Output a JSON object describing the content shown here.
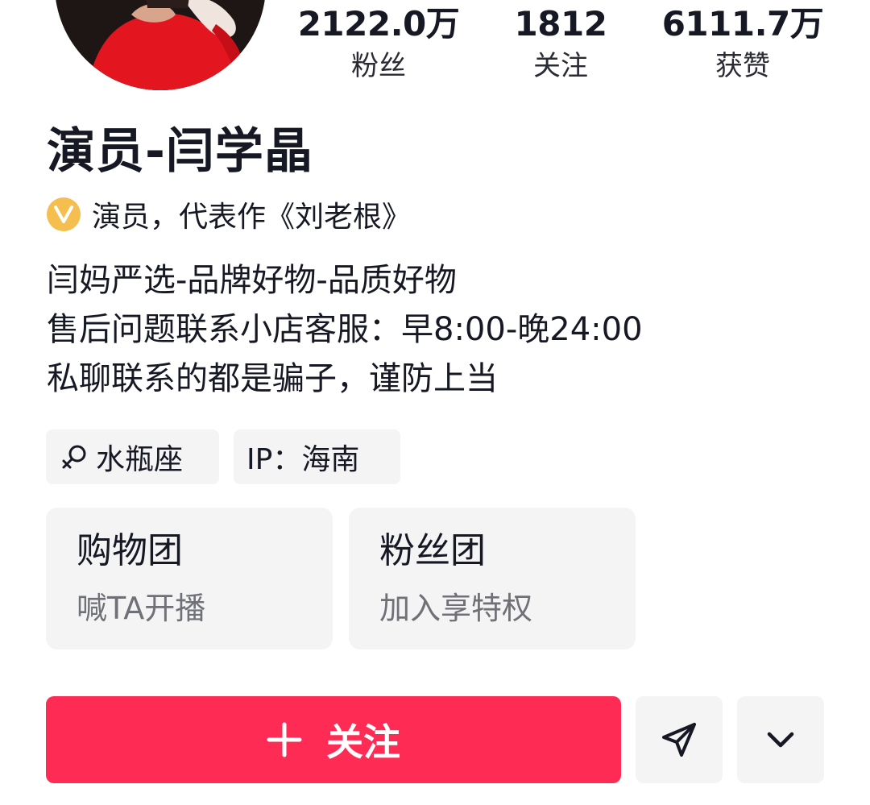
{
  "profile": {
    "name": "演员-闫学晶",
    "verified_badge": "V",
    "verified_text": "演员，代表作《刘老根》",
    "bio_lines": [
      "闫妈严选-品牌好物-品质好物",
      "售后问题联系小店客服：早8:00-晚24:00",
      "私聊联系的都是骗子，谨防上当"
    ]
  },
  "stats": {
    "followers": {
      "value": "2122.0万",
      "label": "粉丝"
    },
    "following": {
      "value": "1812",
      "label": "关注"
    },
    "likes": {
      "value": "6111.7万",
      "label": "获赞"
    }
  },
  "tags": {
    "zodiac": "水瓶座",
    "ip": "IP：海南"
  },
  "cards": [
    {
      "title": "购物团",
      "subtitle": "喊TA开播"
    },
    {
      "title": "粉丝团",
      "subtitle": "加入享特权"
    }
  ],
  "actions": {
    "follow_label": "关注",
    "follow_color": "#fe2c55",
    "message_icon": "send-icon",
    "more_icon": "chevron-down-icon"
  }
}
